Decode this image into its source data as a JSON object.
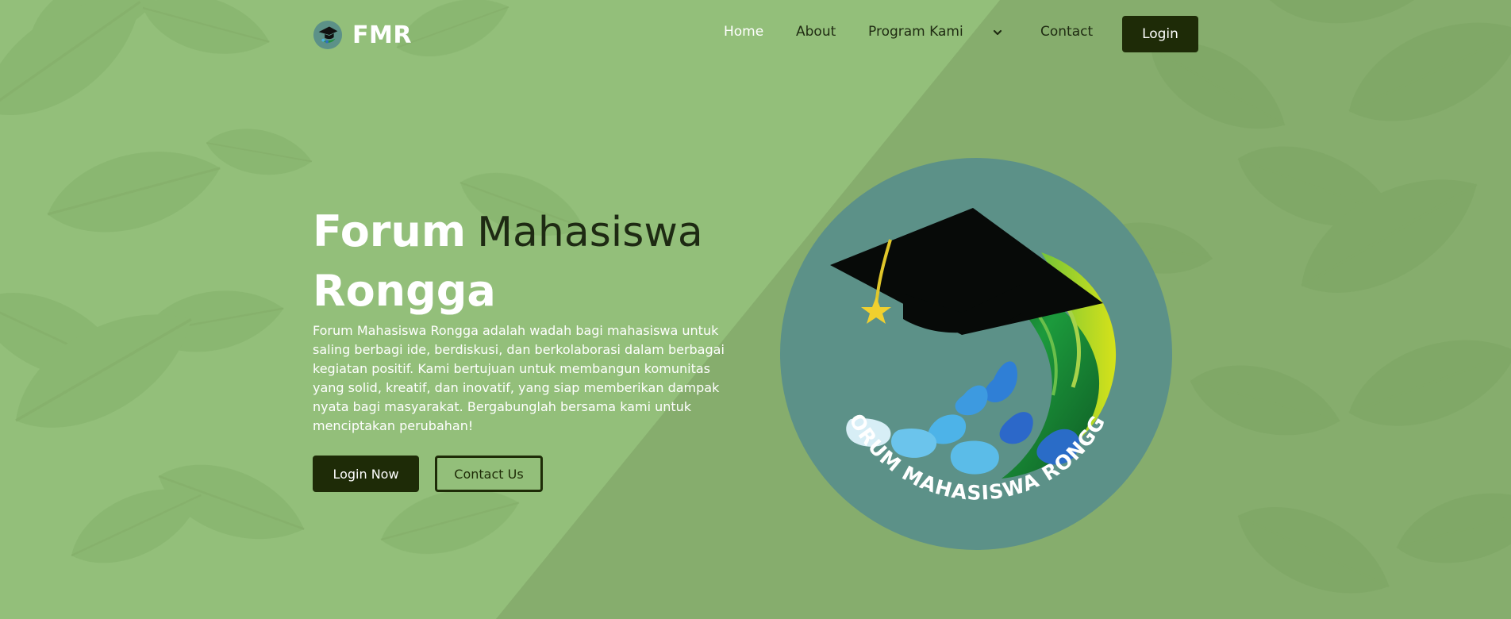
{
  "brand": {
    "name": "FMR",
    "logo_icon": "fmr-logo-icon"
  },
  "nav": {
    "items": [
      {
        "label": "Home",
        "active": true
      },
      {
        "label": "About",
        "active": false
      },
      {
        "label": "Program Kami",
        "active": false
      },
      {
        "label": "Contact",
        "active": false
      }
    ],
    "dropdown_icon": "chevron-down-icon",
    "login_label": "Login"
  },
  "hero": {
    "title_bold_1": "Forum",
    "title_light": "Mahasiswa",
    "title_bold_2": "Rongga",
    "description": "Forum Mahasiswa Rongga adalah wadah bagi mahasiswa untuk saling berbagi ide, berdiskusi, dan berkolaborasi dalam berbagai kegiatan positif. Kami bertujuan untuk membangun komunitas yang solid, kreatif, dan inovatif, yang siap memberikan dampak nyata bagi masyarakat. Bergabunglah bersama kami untuk menciptakan perubahan!",
    "primary_button": "Login Now",
    "secondary_button": "Contact Us",
    "logo_caption": "FORUM MAHASISWA RONGGA"
  },
  "colors": {
    "background": "#93bf7a",
    "diagonal_shade": "#86ad6d",
    "button_dark": "#1e2b07",
    "logo_circle": "#5c9188"
  }
}
